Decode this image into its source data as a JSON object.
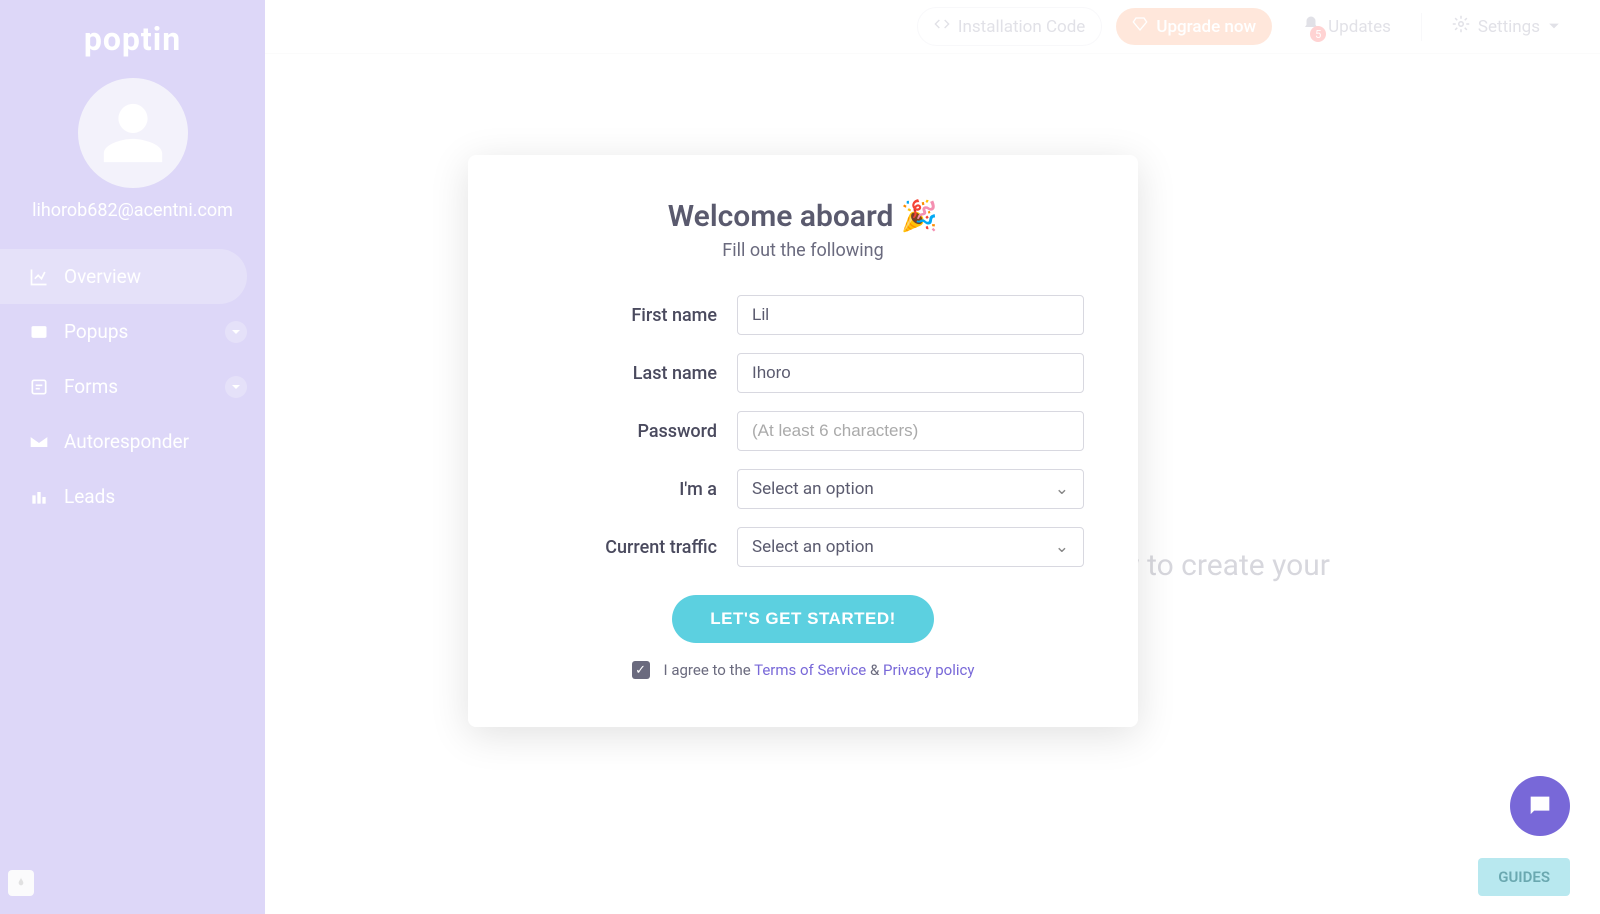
{
  "brand": "poptin",
  "user_email": "lihorob682@acentni.com",
  "sidebar": {
    "items": [
      {
        "label": "Overview"
      },
      {
        "label": "Popups"
      },
      {
        "label": "Forms"
      },
      {
        "label": "Autoresponder"
      },
      {
        "label": "Leads"
      }
    ]
  },
  "header": {
    "install": "Installation Code",
    "upgrade": "Upgrade now",
    "updates": "Updates",
    "updates_count": "5",
    "settings": "Settings"
  },
  "bg_text": "ow to create your",
  "modal": {
    "title": "Welcome aboard 🎉",
    "subtitle": "Fill out the following",
    "labels": {
      "first_name": "First name",
      "last_name": "Last name",
      "password": "Password",
      "im_a": "I'm a",
      "traffic": "Current traffic"
    },
    "values": {
      "first_name": "Lil",
      "last_name": "Ihoro",
      "password": ""
    },
    "placeholders": {
      "password": "(At least 6 characters)",
      "select": "Select an option"
    },
    "submit": "LET'S GET STARTED!",
    "agree_prefix": "I agree to the ",
    "terms": "Terms of Service",
    "agree_mid": " & ",
    "privacy": "Privacy policy"
  },
  "guides": "GUIDES"
}
